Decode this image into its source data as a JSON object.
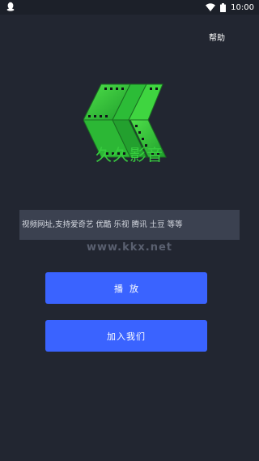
{
  "status_bar": {
    "time": "10:00"
  },
  "header": {
    "help_label": "帮助"
  },
  "app": {
    "name": "久久影音"
  },
  "search": {
    "placeholder": "视频网址,支持爱奇艺 优酷 乐视 腾讯 土豆 等等"
  },
  "watermark": {
    "text": "www.kkx.net"
  },
  "buttons": {
    "play_label": "播放",
    "join_label": "加入我们"
  },
  "colors": {
    "background": "#222631",
    "accent": "#3a63ff",
    "brand_green": "#38cc3f",
    "input_bg": "#3b4150"
  },
  "icons": [
    "qq-icon",
    "wifi-icon",
    "battery-icon"
  ]
}
